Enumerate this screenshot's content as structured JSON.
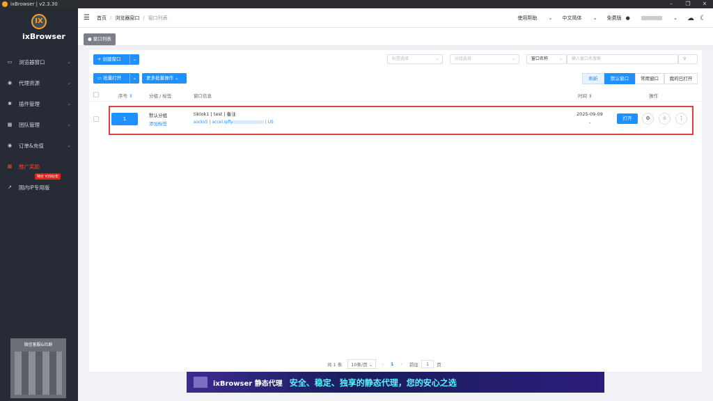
{
  "titlebar": {
    "title": "ixBrowser | v2.3.30"
  },
  "sidebar": {
    "logo_text": "ixBrowser",
    "items": [
      {
        "label": "浏览器窗口",
        "icon": "window-icon"
      },
      {
        "label": "代理资源",
        "icon": "globe-icon"
      },
      {
        "label": "插件管理",
        "icon": "puzzle-icon"
      },
      {
        "label": "团队管理",
        "icon": "team-icon"
      },
      {
        "label": "订单&充值",
        "icon": "order-icon"
      },
      {
        "label": "推广奖励",
        "icon": "gift-icon"
      },
      {
        "label": "国内IP专用版",
        "icon": "external-icon"
      }
    ],
    "promo_badge": "特价 ¥399/年",
    "qr_caption": "微信客服&社群"
  },
  "header": {
    "breadcrumb": [
      "首页",
      "浏览器窗口",
      "窗口列表"
    ],
    "help": "使用帮助",
    "language": "中文简体",
    "plan": "免费版"
  },
  "tab": {
    "label": "窗口列表"
  },
  "toolbar": {
    "create": "+ 创建窗口",
    "tag_placeholder": "标签选择",
    "group_placeholder": "分组选择",
    "search_field": "窗口名称",
    "search_placeholder": "输入窗口名搜索",
    "batch_open": "批量打开",
    "more_batch": "更多批量操作",
    "refresh": "刷新",
    "view_default": "默认窗口",
    "view_common": "常用窗口",
    "view_opened": "我的已打开"
  },
  "table": {
    "headers": [
      "序号",
      "分组 / 标签",
      "窗口信息",
      "时间",
      "操作"
    ],
    "rows": [
      {
        "index": "1",
        "group": "默认分组",
        "add_tag": "添加标签",
        "info": "tiktok1 | test | 备注",
        "proxy_type": "socks5",
        "proxy_host": "accel.ipfly",
        "proxy_country": "US",
        "date": "2025-09-09",
        "date2": "-",
        "open": "打开"
      }
    ]
  },
  "pagination": {
    "total": "共 1 条",
    "per_page": "10条/页",
    "current": "1",
    "goto": "前往",
    "goto_value": "1",
    "page_unit": "页"
  },
  "banner": {
    "brand": "ixBrowser 静态代理",
    "slogan": "安全、稳定、独享的静态代理，您的安心之选"
  }
}
